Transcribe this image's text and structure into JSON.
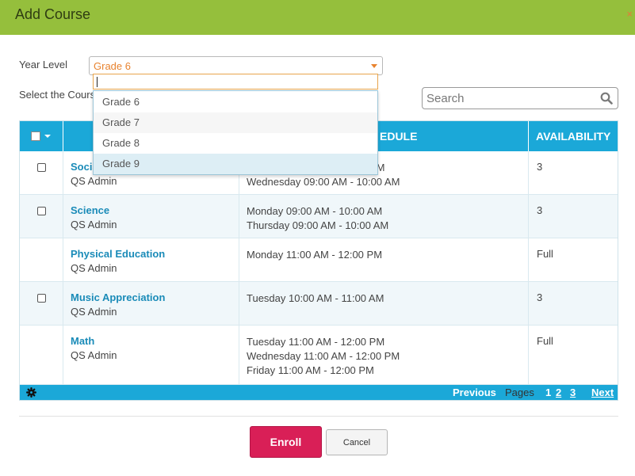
{
  "dialog": {
    "title": "Add Course",
    "close_glyph": "×"
  },
  "form": {
    "year_level_label": "Year Level",
    "year_level_value": "Grade 6",
    "select_course_label": "Select the Cours",
    "search_placeholder": "Search"
  },
  "dropdown": {
    "search_value": "",
    "options": [
      "Grade 6",
      "Grade 7",
      "Grade 8",
      "Grade 9"
    ],
    "highlighted": "Grade 9"
  },
  "grid": {
    "headers": {
      "schedule": "EDULE",
      "availability": "AVAILABILITY"
    },
    "rows": [
      {
        "name": "Socia",
        "instructor": "QS Admin",
        "schedule": [
          "AM",
          "Wednesday 09:00 AM - 10:00 AM"
        ],
        "availability": "3",
        "selectable": true
      },
      {
        "name": "Science",
        "instructor": "QS Admin",
        "schedule": [
          "Monday 09:00 AM - 10:00 AM",
          "Thursday 09:00 AM - 10:00 AM"
        ],
        "availability": "3",
        "selectable": true
      },
      {
        "name": "Physical Education",
        "instructor": "QS Admin",
        "schedule": [
          "Monday 11:00 AM - 12:00 PM"
        ],
        "availability": "Full",
        "selectable": false
      },
      {
        "name": "Music Appreciation",
        "instructor": "QS Admin",
        "schedule": [
          "Tuesday 10:00 AM - 11:00 AM"
        ],
        "availability": "3",
        "selectable": true
      },
      {
        "name": "Math",
        "instructor": "QS Admin",
        "schedule": [
          "Tuesday 11:00 AM - 12:00 PM",
          "Wednesday 11:00 AM - 12:00 PM",
          "Friday 11:00 AM - 12:00 PM"
        ],
        "availability": "Full",
        "selectable": false
      }
    ]
  },
  "pager": {
    "previous": "Previous",
    "pages_label": "Pages",
    "pages": [
      "1",
      "2",
      "3"
    ],
    "next": "Next"
  },
  "buttons": {
    "enroll": "Enroll",
    "cancel": "Cancel"
  },
  "colors": {
    "header_green": "#95bf3c",
    "grid_blue": "#1ba8d8",
    "enroll_red": "#d91f57",
    "accent_orange": "#e8832f",
    "link_blue": "#1a8bb8"
  },
  "icons": {
    "search": "magnifier-icon",
    "gear": "gear-icon",
    "close": "close-icon"
  }
}
